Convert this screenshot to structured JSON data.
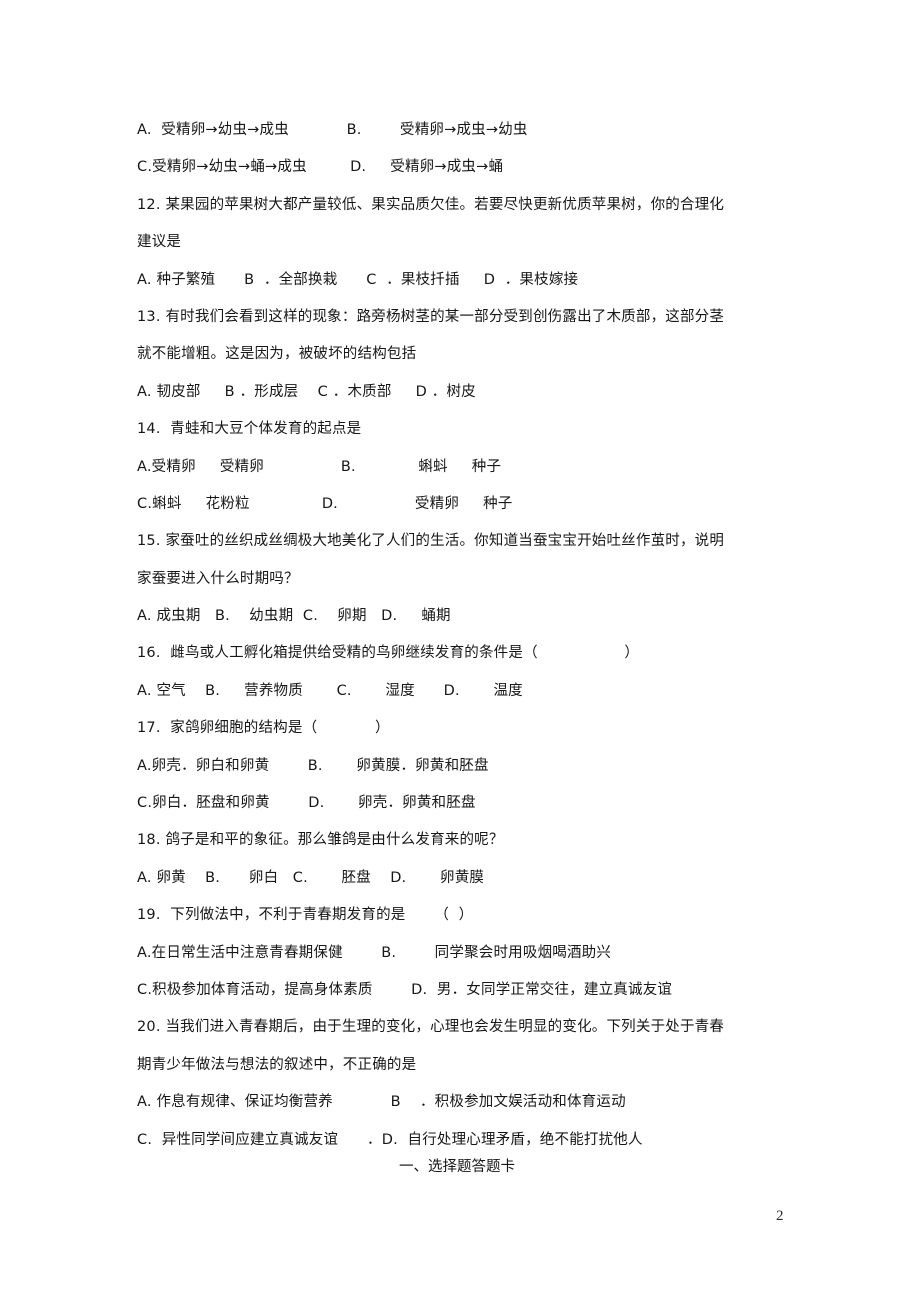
{
  "document": {
    "page_number": "2",
    "answer_sheet_heading": "一、选择题答题卡",
    "lines": [
      {
        "id": "q11-opts-ab",
        "text": "A.  受精卵→幼虫→成虫            B.        受精卵→成虫→幼虫"
      },
      {
        "id": "q11-opts-cd",
        "text": "C.受精卵→幼虫→蛹→成虫         D.     受精卵→成虫→蛹"
      },
      {
        "id": "q12-stem-1",
        "text": "12. 某果园的苹果树大都产量较低、果实品质欠佳。若要尽快更新优质苹果树，你的合理化"
      },
      {
        "id": "q12-stem-2",
        "text": "建议是"
      },
      {
        "id": "q12-opts",
        "text": "A. 种子繁殖      B  ．全部换栽      C  ．果枝扦插     D  ．果枝嫁接"
      },
      {
        "id": "q13-stem-1",
        "text": "13. 有时我们会看到这样的现象：路旁杨树茎的某一部分受到创伤露出了木质部，这部分茎"
      },
      {
        "id": "q13-stem-2",
        "text": "就不能增粗。这是因为，被破坏的结构包括"
      },
      {
        "id": "q13-opts",
        "text": "A. 韧皮部     B ．形成层    C ．木质部     D ．树皮"
      },
      {
        "id": "q14-stem",
        "text": "14.  青蛙和大豆个体发育的起点是"
      },
      {
        "id": "q14-opts-ab",
        "text": "A.受精卵     受精卵                B.             蝌蚪     种子"
      },
      {
        "id": "q14-opts-cd",
        "text": "C.蝌蚪     花粉粒               D.                受精卵     种子"
      },
      {
        "id": "q15-stem-1",
        "text": "15. 家蚕吐的丝织成丝绸极大地美化了人们的生活。你知道当蚕宝宝开始吐丝作茧时，说明"
      },
      {
        "id": "q15-stem-2",
        "text": "家蚕要进入什么时期吗？"
      },
      {
        "id": "q15-opts",
        "text": "A. 成虫期   B.    幼虫期  C.    卵期   D.     蛹期"
      },
      {
        "id": "q16-stem",
        "text": "16.  雌鸟或人工孵化箱提供给受精的鸟卵继续发育的条件是（                  ）"
      },
      {
        "id": "q16-opts",
        "text": "A. 空气    B.     营养物质       C.       湿度      D.       温度"
      },
      {
        "id": "q17-stem",
        "text": "17.  家鸽卵细胞的结构是（            ）"
      },
      {
        "id": "q17-opts-ab",
        "text": "A.卵壳．卵白和卵黄        B.       卵黄膜．卵黄和胚盘"
      },
      {
        "id": "q17-opts-cd",
        "text": "C.卵白．胚盘和卵黄        D.       卵壳．卵黄和胚盘"
      },
      {
        "id": "q18-stem",
        "text": "18. 鸽子是和平的象征。那么雏鸽是由什么发育来的呢？"
      },
      {
        "id": "q18-opts",
        "text": "A. 卵黄    B.      卵白   C.       胚盘    D.       卵黄膜"
      },
      {
        "id": "q19-stem",
        "text": "19.  下列做法中，不利于青春期发育的是      （  ）"
      },
      {
        "id": "q19-opts-ab",
        "text": "A.在日常生活中注意青春期保健        B.        同学聚会时用吸烟喝酒助兴"
      },
      {
        "id": "q19-opts-cd",
        "text": "C.积极参加体育活动，提高身体素质        D.  男．女同学正常交往，建立真诚友谊"
      },
      {
        "id": "q20-stem-1",
        "text": "20. 当我们进入青春期后，由于生理的变化，心理也会发生明显的变化。下列关于处于青春"
      },
      {
        "id": "q20-stem-2",
        "text": "期青少年做法与想法的叙述中，不正确的是"
      },
      {
        "id": "q20-opts-ab",
        "text": "A. 作息有规律、保证均衡营养            B    ．积极参加文娱活动和体育运动"
      },
      {
        "id": "q20-opts-cd",
        "text": "C.  异性同学间应建立真诚友谊      ．D.  自行处理心理矛盾，绝不能打扰他人"
      }
    ]
  }
}
